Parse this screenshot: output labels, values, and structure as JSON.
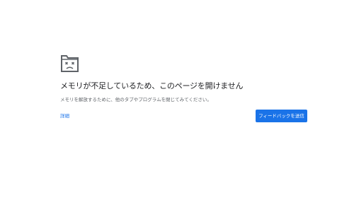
{
  "error": {
    "icon": "sad-folder-icon",
    "title": "メモリが不足しているため、このページを開けません",
    "message": "メモリを解放するために、他のタブやプログラムを閉じてみてください。",
    "details_label": "詳細",
    "feedback_button_label": "フィードバックを送信"
  },
  "colors": {
    "text_primary": "#202124",
    "text_secondary": "#5f6368",
    "link": "#1a73e8",
    "button_bg": "#1a73e8",
    "button_text": "#ffffff"
  }
}
